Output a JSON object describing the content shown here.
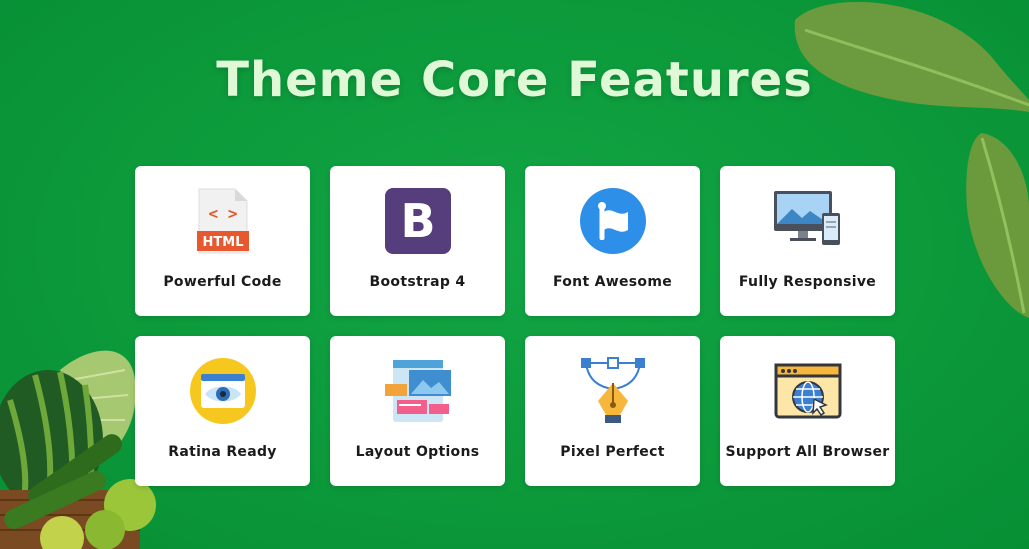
{
  "heading": "Theme Core Features",
  "features": [
    {
      "label": "Powerful Code",
      "icon": "html-file-icon"
    },
    {
      "label": "Bootstrap 4",
      "icon": "bootstrap-icon"
    },
    {
      "label": "Font Awesome",
      "icon": "font-awesome-flag-icon"
    },
    {
      "label": "Fully Responsive",
      "icon": "responsive-devices-icon"
    },
    {
      "label": "Ratina Ready",
      "icon": "retina-eye-icon"
    },
    {
      "label": "Layout Options",
      "icon": "layout-options-icon"
    },
    {
      "label": "Pixel Perfect",
      "icon": "pen-tool-icon"
    },
    {
      "label": "Support All Browser",
      "icon": "browser-globe-icon"
    }
  ],
  "html_icon_text": "HTML",
  "html_icon_brackets": "< >",
  "bootstrap_letter": "B",
  "colors": {
    "background": "#0e9a3e",
    "title": "#dff8d6",
    "card": "#ffffff",
    "bootstrap": "#563d7c",
    "font_awesome": "#2d8fe8",
    "html_orange": "#e8582e"
  }
}
